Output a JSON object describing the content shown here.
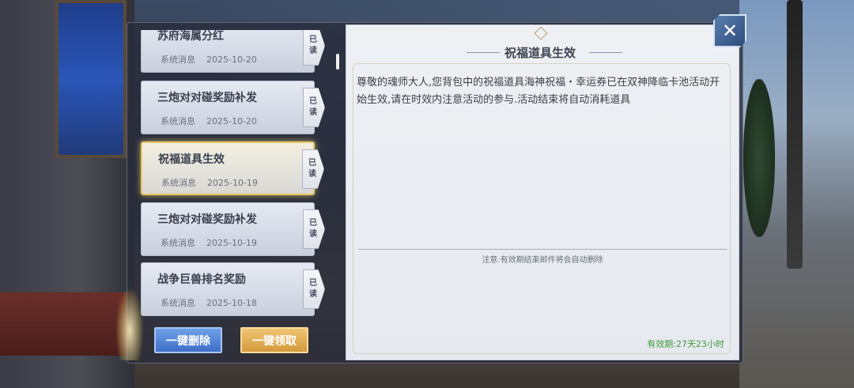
{
  "mail_list": {
    "items": [
      {
        "title": "苏府海属分红",
        "category": "系统消息",
        "date": "2025-10-20",
        "status": "已读",
        "selected": false
      },
      {
        "title": "三炮对对碰奖励补发",
        "category": "系统消息",
        "date": "2025-10-20",
        "status": "已读",
        "selected": false
      },
      {
        "title": "祝福道具生效",
        "category": "系统消息",
        "date": "2025-10-19",
        "status": "已读",
        "selected": true
      },
      {
        "title": "三炮对对碰奖励补发",
        "category": "系统消息",
        "date": "2025-10-19",
        "status": "已读",
        "selected": false
      },
      {
        "title": "战争巨兽排名奖励",
        "category": "系统消息",
        "date": "2025-10-18",
        "status": "已读",
        "selected": false
      }
    ]
  },
  "buttons": {
    "delete_all": "一键删除",
    "claim_all": "一键领取"
  },
  "reader": {
    "title": "祝福道具生效",
    "body": "尊敬的魂师大人,您背包中的祝福道具海神祝福・幸运券已在双神降临卡池活动开始生效,请在时效内注意活动的参与.活动结束将自动消耗道具",
    "note": "注意:有效期结束邮件将会自动删除",
    "expiry": "有效期:27天23小时"
  },
  "close": {
    "icon": "close-icon",
    "glyph": "✕"
  },
  "colors": {
    "expiry_green": "#3f9a3a",
    "selected_border": "#e7c96a",
    "delete_button": "#3e6fc8",
    "claim_button": "#d59a3c"
  }
}
